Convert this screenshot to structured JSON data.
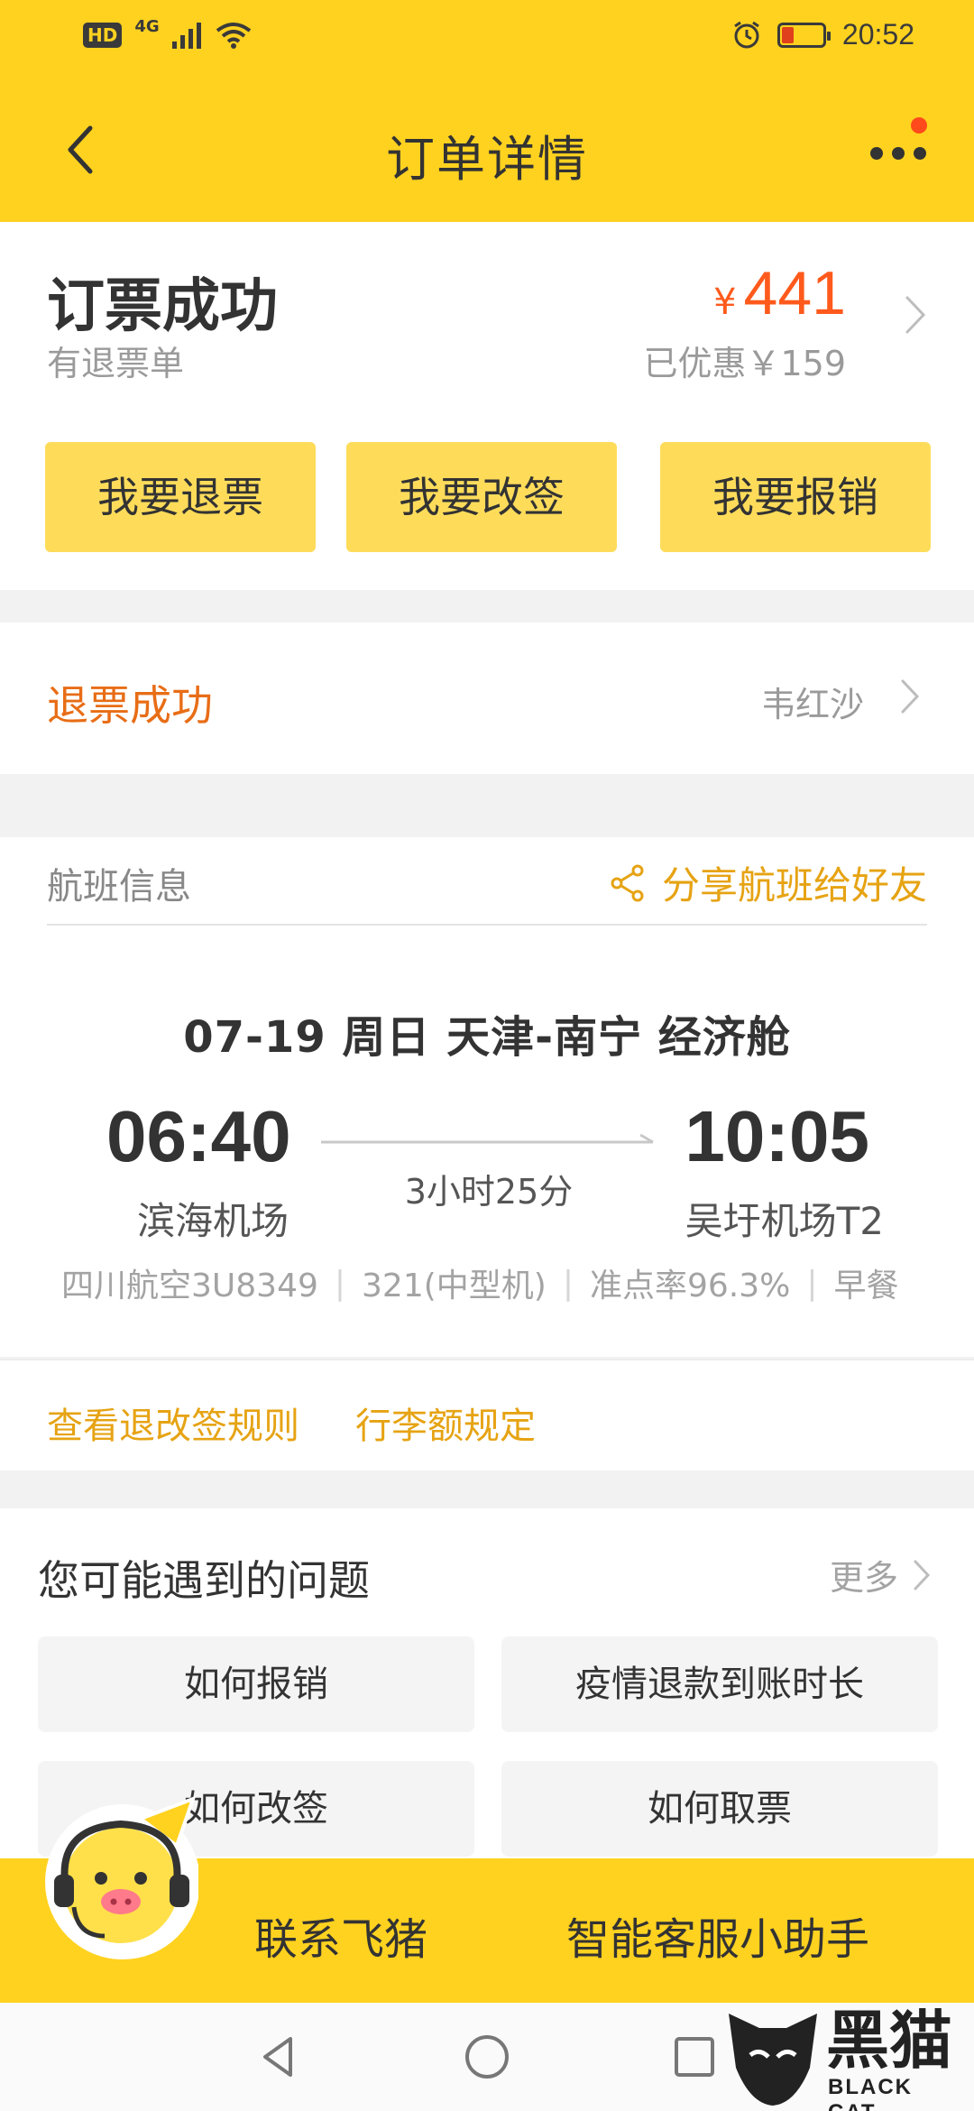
{
  "status_bar": {
    "hd": "HD",
    "network": "4G",
    "time": "20:52",
    "battery_fraction": 0.3
  },
  "navbar": {
    "title": "订单详情",
    "back_icon": "chevron-left-icon",
    "more_icon": "ellipsis-icon",
    "accent": "#ffd21f"
  },
  "order": {
    "status": "订票成功",
    "sub": "有退票单",
    "currency": "¥",
    "price": "441",
    "discount": "已优惠￥159",
    "price_color": "#ff5a1c",
    "actions": [
      "我要退票",
      "我要改签",
      "我要报销"
    ]
  },
  "refund": {
    "status": "退票成功",
    "passenger": "韦红沙"
  },
  "flight": {
    "section_title": "航班信息",
    "share_label": "分享航班给好友",
    "summary": "07-19  周日  天津-南宁  经济舱",
    "departure_time": "06:40",
    "arrival_time": "10:05",
    "duration": "3小时25分",
    "departure_airport": "滨海机场",
    "arrival_airport": "吴圩机场T2",
    "meta": [
      "四川航空3U8349",
      "321(中型机)",
      "准点率96.3%",
      "早餐"
    ]
  },
  "rules": {
    "change_rules": "查看退改签规则",
    "baggage_rules": "行李额规定"
  },
  "faq": {
    "title": "您可能遇到的问题",
    "more": "更多",
    "items": [
      "如何报销",
      "疫情退款到账时长",
      "如何改签",
      "如何取票"
    ]
  },
  "contact": {
    "contact_label": "联系飞猪",
    "assistant_label": "智能客服小助手"
  },
  "watermark": {
    "text": "黑猫",
    "sub": "BLACK CAT"
  }
}
